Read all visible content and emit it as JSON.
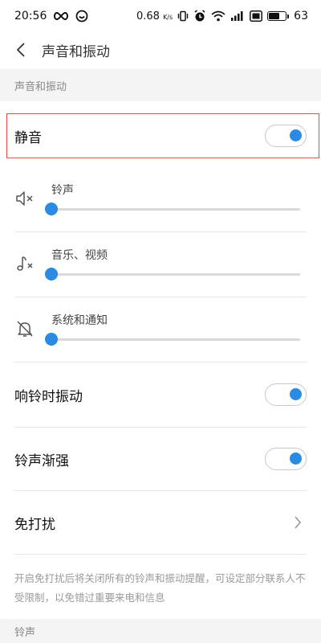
{
  "status_bar": {
    "time": "20:56",
    "speed": "0.68",
    "speed_unit": "K/s",
    "battery": "63",
    "battery_level": 0.63
  },
  "header": {
    "title": "声音和振动"
  },
  "section": {
    "title": "声音和振动"
  },
  "mute": {
    "label": "静音",
    "on": true
  },
  "sliders": [
    {
      "label": "铃声",
      "icon": "speaker-muted-icon",
      "value": 0
    },
    {
      "label": "音乐、视频",
      "icon": "music-muted-icon",
      "value": 0
    },
    {
      "label": "系统和通知",
      "icon": "bell-muted-icon",
      "value": 0
    }
  ],
  "vibrate_on_ring": {
    "label": "响铃时振动",
    "on": true
  },
  "ringtone_crescendo": {
    "label": "铃声渐强",
    "on": true
  },
  "dnd": {
    "label": "免打扰"
  },
  "description": "开启免打扰后将关闭所有的铃声和振动提醒，可设定部分联系人不受限制，以免错过重要来电和信息",
  "footer_section": {
    "title": "铃声"
  },
  "colors": {
    "accent": "#2b8ae2",
    "highlight_border": "#e64a43",
    "section_bg": "#f4f4f4"
  }
}
